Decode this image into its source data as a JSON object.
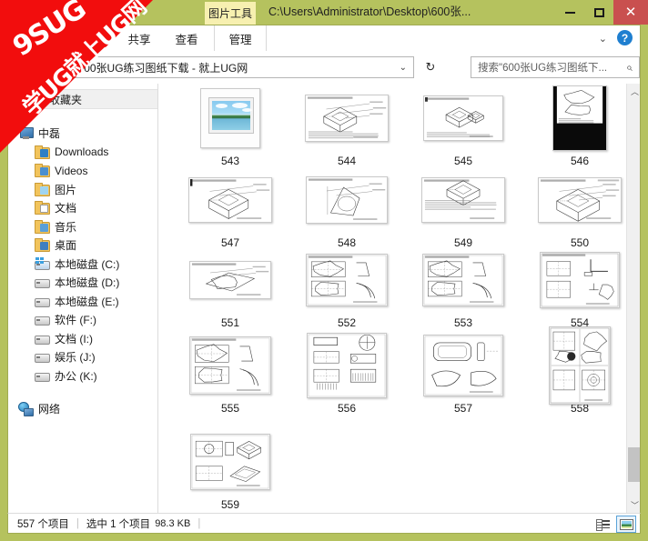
{
  "window": {
    "title_path": "C:\\Users\\Administrator\\Desktop\\600张...",
    "contextual_tab": "图片工具",
    "minimize_label": "最小化",
    "maximize_label": "最大化",
    "close_label": "关闭"
  },
  "ribbon": {
    "tabs": [
      "共享",
      "查看",
      "管理"
    ],
    "collapse_glyph": "⌄",
    "help_glyph": "?"
  },
  "address": {
    "up_glyph": "↑",
    "separator": "▸",
    "path_text": "600张UG练习图纸下载 - 就上UG网",
    "dropdown_glyph": "⌄",
    "refresh_glyph": "↻"
  },
  "search": {
    "placeholder": "搜索\"600张UG练习图纸下...",
    "icon_glyph": "⌕"
  },
  "sidebar": {
    "favorites_header": "收藏夹",
    "items": [
      {
        "label": "中磊",
        "icon": "computer-icon",
        "indent": 10,
        "type": "pc"
      },
      {
        "label": "Downloads",
        "icon": "downloads-folder-icon",
        "indent": 28,
        "type": "fold",
        "badge": "bdl"
      },
      {
        "label": "Videos",
        "icon": "videos-folder-icon",
        "indent": 28,
        "type": "fold",
        "badge": "bvd"
      },
      {
        "label": "图片",
        "icon": "pictures-folder-icon",
        "indent": 28,
        "type": "fold",
        "badge": "bpic"
      },
      {
        "label": "文档",
        "icon": "documents-folder-icon",
        "indent": 28,
        "type": "fold",
        "badge": "bdoc"
      },
      {
        "label": "音乐",
        "icon": "music-folder-icon",
        "indent": 28,
        "type": "fold",
        "badge": "bmus"
      },
      {
        "label": "桌面",
        "icon": "desktop-folder-icon",
        "indent": 28,
        "type": "fold",
        "badge": "bdsk"
      },
      {
        "label": "本地磁盘 (C:)",
        "icon": "system-drive-icon",
        "indent": 28,
        "type": "drv-sys"
      },
      {
        "label": "本地磁盘 (D:)",
        "icon": "drive-icon",
        "indent": 28,
        "type": "drv"
      },
      {
        "label": "本地磁盘 (E:)",
        "icon": "drive-icon",
        "indent": 28,
        "type": "drv"
      },
      {
        "label": "软件 (F:)",
        "icon": "drive-icon",
        "indent": 28,
        "type": "drv"
      },
      {
        "label": "文档 (I:)",
        "icon": "drive-icon",
        "indent": 28,
        "type": "drv"
      },
      {
        "label": "娱乐 (J:)",
        "icon": "drive-icon",
        "indent": 28,
        "type": "drv"
      },
      {
        "label": "办公 (K:)",
        "icon": "drive-icon",
        "indent": 28,
        "type": "drv"
      },
      {
        "label": "网络",
        "icon": "network-icon",
        "indent": 10,
        "type": "net"
      }
    ]
  },
  "files": {
    "items": [
      {
        "name": "543",
        "kind": "photo",
        "w": 66,
        "h": 66,
        "selected": false
      },
      {
        "name": "544",
        "kind": "drawing",
        "w": 92,
        "h": 52,
        "selected": false,
        "style": "iso-a"
      },
      {
        "name": "545",
        "kind": "drawing",
        "w": 88,
        "h": 50,
        "selected": false,
        "style": "iso-b"
      },
      {
        "name": "546",
        "kind": "drawing",
        "w": 60,
        "h": 72,
        "selected": false,
        "style": "dark-scan"
      },
      {
        "name": "547",
        "kind": "drawing",
        "w": 92,
        "h": 50,
        "selected": false,
        "style": "iso-c"
      },
      {
        "name": "548",
        "kind": "drawing",
        "w": 90,
        "h": 52,
        "selected": false,
        "style": "iso-d"
      },
      {
        "name": "549",
        "kind": "drawing",
        "w": 92,
        "h": 50,
        "selected": false,
        "style": "iso-e"
      },
      {
        "name": "550",
        "kind": "drawing",
        "w": 92,
        "h": 50,
        "selected": false,
        "style": "iso-f"
      },
      {
        "name": "551",
        "kind": "drawing",
        "w": 90,
        "h": 42,
        "selected": false,
        "style": "iso-g"
      },
      {
        "name": "552",
        "kind": "drawing",
        "w": 90,
        "h": 58,
        "selected": false,
        "style": "multi-a"
      },
      {
        "name": "553",
        "kind": "drawing",
        "w": 90,
        "h": 58,
        "selected": false,
        "style": "multi-a"
      },
      {
        "name": "554",
        "kind": "drawing",
        "w": 88,
        "h": 62,
        "selected": false,
        "style": "multi-b"
      },
      {
        "name": "555",
        "kind": "drawing",
        "w": 90,
        "h": 64,
        "selected": false,
        "style": "multi-a"
      },
      {
        "name": "556",
        "kind": "drawing",
        "w": 88,
        "h": 72,
        "selected": false,
        "style": "multi-c"
      },
      {
        "name": "557",
        "kind": "drawing",
        "w": 88,
        "h": 68,
        "selected": false,
        "style": "multi-d"
      },
      {
        "name": "558",
        "kind": "drawing",
        "w": 68,
        "h": 86,
        "selected": false,
        "style": "multi-e"
      },
      {
        "name": "559",
        "kind": "drawing",
        "w": 88,
        "h": 62,
        "selected": false,
        "style": "multi-f"
      }
    ]
  },
  "scrollbar": {
    "up_glyph": "︿",
    "down_glyph": "﹀"
  },
  "statusbar": {
    "item_count": "557 个项目",
    "divider": "|",
    "selection": "选中 1 个项目",
    "selection_size": "98.3 KB",
    "divider2": "|",
    "details_view_label": "详细信息",
    "icons_view_label": "大图标"
  },
  "watermark": {
    "line1": "9SUG",
    "line2": "学UG就上UG网",
    "color": "#f20d0d"
  },
  "colors": {
    "frame": "#b5c25e",
    "close_button": "#c9504f",
    "contextual_tab": "#f7f0b0",
    "selection": "#cde8ff"
  }
}
